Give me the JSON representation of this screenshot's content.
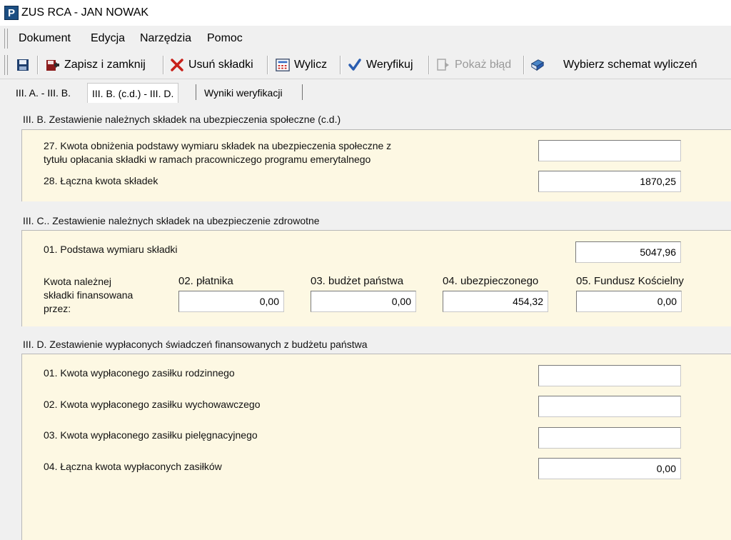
{
  "window": {
    "title": "ZUS RCA - JAN NOWAK",
    "app_icon_letter": "P"
  },
  "menu": [
    "Dokument",
    "Edycja",
    "Narzędzia",
    "Pomoc"
  ],
  "toolbar": {
    "zapisz": "Zapisz i zamknij",
    "usun": "Usuń składki",
    "wylicz": "Wylicz",
    "weryfikuj": "Weryfikuj",
    "pokaz_blad": "Pokaż błąd",
    "wybierz": "Wybierz schemat wyliczeń"
  },
  "tabs": [
    "III. A. - III. B.",
    "III. B. (c.d.) - III. D.",
    "Wyniki weryfikacji"
  ],
  "sectionB": {
    "title": "III. B. Zestawienie należnych składek na ubezpieczenia społeczne (c.d.)",
    "f27_label_line1": "27. Kwota obniżenia podstawy wymiaru składek na ubezpieczenia społeczne z",
    "f27_label_line2": "tytułu opłacania składki w ramach pracowniczego programu emerytalnego",
    "f27_value": "",
    "f28_label": "28. Łączna kwota składek",
    "f28_value": "1870,25"
  },
  "sectionC": {
    "title": "III. C.. Zestawienie należnych składek na ubezpieczenie zdrowotne",
    "f01_label": "01. Podstawa wymiaru składki",
    "f01_value": "5047,96",
    "financed_line1": "Kwota należnej",
    "financed_line2": "składki finansowana",
    "financed_line3": "przez:",
    "cols": [
      {
        "label": "02. płatnika",
        "value": "0,00"
      },
      {
        "label": "03. budżet państwa",
        "value": "0,00"
      },
      {
        "label": "04. ubezpieczonego",
        "value": "454,32"
      },
      {
        "label": "05. Fundusz Kościelny",
        "value": "0,00"
      }
    ]
  },
  "sectionD": {
    "title": "III. D. Zestawienie wypłaconych świadczeń finansowanych z budżetu państwa",
    "rows": [
      {
        "label": "01. Kwota wypłaconego zasiłku rodzinnego",
        "value": ""
      },
      {
        "label": "02. Kwota wypłaconego zasiłku wychowawczego",
        "value": ""
      },
      {
        "label": "03. Kwota wypłaconego zasiłku pielęgnacyjnego",
        "value": ""
      },
      {
        "label": "04. Łączna kwota wypłaconych zasiłków",
        "value": "0,00"
      }
    ]
  },
  "icons": {
    "save": "floppy-disk-icon",
    "save_close": "save-close-icon",
    "delete": "red-x-icon",
    "calculate": "calculator-icon",
    "verify": "checkmark-icon",
    "show_error": "error-info-icon",
    "scheme": "book-icon"
  },
  "colors": {
    "panel_bg": "#fdf8e3",
    "app_icon": "#1c4e82",
    "delete_x": "#c8201a",
    "verify_check": "#2a5db0"
  }
}
